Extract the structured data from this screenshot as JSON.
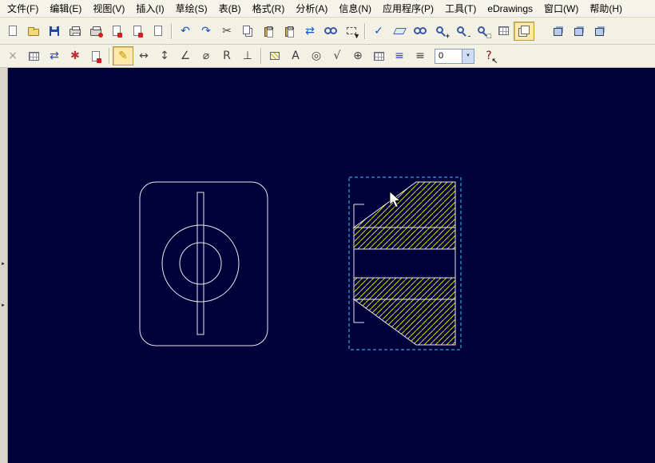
{
  "colors": {
    "canvas_bg": "#00003b",
    "line": "#e9e9e9",
    "hatch": "#d9d900",
    "selection": "#3cc8f0",
    "toolbar_bg": "#f3f1e4",
    "menu_bg": "#f6f4ea",
    "accent_blue": "#1a50c8"
  },
  "menubar": {
    "items": [
      {
        "name": "menu-file",
        "label": "文件(F)"
      },
      {
        "name": "menu-edit",
        "label": "编辑(E)"
      },
      {
        "name": "menu-view",
        "label": "视图(V)"
      },
      {
        "name": "menu-insert",
        "label": "插入(I)"
      },
      {
        "name": "menu-sketch",
        "label": "草绘(S)"
      },
      {
        "name": "menu-table",
        "label": "表(B)"
      },
      {
        "name": "menu-format",
        "label": "格式(R)"
      },
      {
        "name": "menu-analysis",
        "label": "分析(A)"
      },
      {
        "name": "menu-info",
        "label": "信息(N)"
      },
      {
        "name": "menu-applications",
        "label": "应用程序(P)"
      },
      {
        "name": "menu-tools",
        "label": "工具(T)"
      },
      {
        "name": "menu-edrawings",
        "label": "eDrawings"
      },
      {
        "name": "menu-window",
        "label": "窗口(W)"
      },
      {
        "name": "menu-help",
        "label": "帮助(H)"
      }
    ]
  },
  "toolbar_main": {
    "buttons": [
      {
        "name": "new-file-button",
        "shape": "page"
      },
      {
        "name": "open-file-button",
        "shape": "folder"
      },
      {
        "name": "save-button",
        "shape": "floppy"
      },
      {
        "name": "print-button",
        "shape": "printer"
      },
      {
        "name": "plot-button",
        "shape": "printer-red"
      },
      {
        "name": "export-button",
        "shape": "page-red"
      },
      {
        "name": "send-mail-button",
        "shape": "page-red"
      },
      {
        "name": "properties-button",
        "shape": "page"
      },
      {
        "type": "sep"
      },
      {
        "name": "undo-button",
        "glyph": "↶",
        "color": "#1a50c8"
      },
      {
        "name": "redo-button",
        "glyph": "↷",
        "color": "#1a50c8"
      },
      {
        "name": "cut-button",
        "glyph": "✂",
        "color": "#444"
      },
      {
        "name": "copy-button",
        "shape": "copy"
      },
      {
        "name": "paste-button",
        "shape": "paste"
      },
      {
        "name": "paste-special-button",
        "shape": "paste"
      },
      {
        "name": "regenerate-model-button",
        "glyph": "⇄",
        "color": "#1a50c8"
      },
      {
        "name": "find-button",
        "shape": "binoc"
      },
      {
        "name": "select-filter-button",
        "shape": "dashed-box",
        "badge": "▼"
      },
      {
        "type": "sep"
      },
      {
        "name": "repaint-button",
        "glyph": "✓",
        "color": "#1a50c8"
      },
      {
        "name": "datum-display-button",
        "shape": "plane"
      },
      {
        "name": "view-manager-button",
        "shape": "binoc"
      },
      {
        "name": "zoom-in-button",
        "shape": "mag",
        "badge": "+"
      },
      {
        "name": "zoom-out-button",
        "shape": "mag",
        "badge": "-"
      },
      {
        "name": "zoom-refit-button",
        "shape": "mag",
        "badge": "□"
      },
      {
        "name": "saved-views-button",
        "shape": "grid"
      },
      {
        "name": "layers-button",
        "shape": "stack",
        "active": true
      },
      {
        "type": "spacer"
      },
      {
        "name": "cube-tool-button-1",
        "shape": "cube"
      },
      {
        "name": "cube-tool-button-2",
        "shape": "cube"
      },
      {
        "name": "cube-tool-button-3",
        "shape": "cube"
      }
    ]
  },
  "toolbar_draft": {
    "buttons": [
      {
        "name": "delete-item-button",
        "glyph": "×",
        "color": "#9a9a9a"
      },
      {
        "name": "modify-table-button",
        "shape": "grid"
      },
      {
        "name": "update-view-button",
        "glyph": "⇄",
        "color": "#1a50c8"
      },
      {
        "name": "regenerate-draft-button",
        "glyph": "✱",
        "color": "#c03030"
      },
      {
        "name": "sheet-setup-button",
        "shape": "page-red"
      },
      {
        "type": "sep"
      },
      {
        "name": "insert-dimension-button",
        "glyph": "✎",
        "color": "#c29200",
        "active": true
      },
      {
        "name": "dim-standard-button",
        "glyph": "↔",
        "color": "#444"
      },
      {
        "name": "dim-vertical-button",
        "glyph": "↕",
        "color": "#444"
      },
      {
        "name": "dim-angle-button",
        "glyph": "∠",
        "color": "#444"
      },
      {
        "name": "dim-diameter-button",
        "glyph": "⌀",
        "color": "#444"
      },
      {
        "name": "dim-radius-button",
        "glyph": "R",
        "color": "#444"
      },
      {
        "name": "dim-ordinate-button",
        "glyph": "⊥",
        "color": "#444"
      },
      {
        "type": "sep"
      },
      {
        "name": "hatch-button",
        "shape": "hatch"
      },
      {
        "name": "note-button",
        "glyph": "A",
        "color": "#333"
      },
      {
        "name": "balloon-button",
        "glyph": "◎",
        "color": "#444"
      },
      {
        "name": "surface-finish-button",
        "glyph": "√",
        "color": "#444"
      },
      {
        "name": "geom-tolerance-button",
        "glyph": "⊕",
        "color": "#444"
      },
      {
        "name": "table-button",
        "shape": "grid"
      },
      {
        "name": "repeat-region-button",
        "glyph": "≡",
        "color": "#1a50c8"
      },
      {
        "name": "format-list-button",
        "glyph": "≡",
        "color": "#444"
      },
      {
        "type": "combo",
        "name": "value-combo",
        "value": "0",
        "arrow": "▼"
      },
      {
        "name": "context-help-button",
        "glyph": "?",
        "color": "#7a1616",
        "badge": "↖"
      }
    ]
  },
  "canvas": {
    "splitter_glyph": "►"
  }
}
